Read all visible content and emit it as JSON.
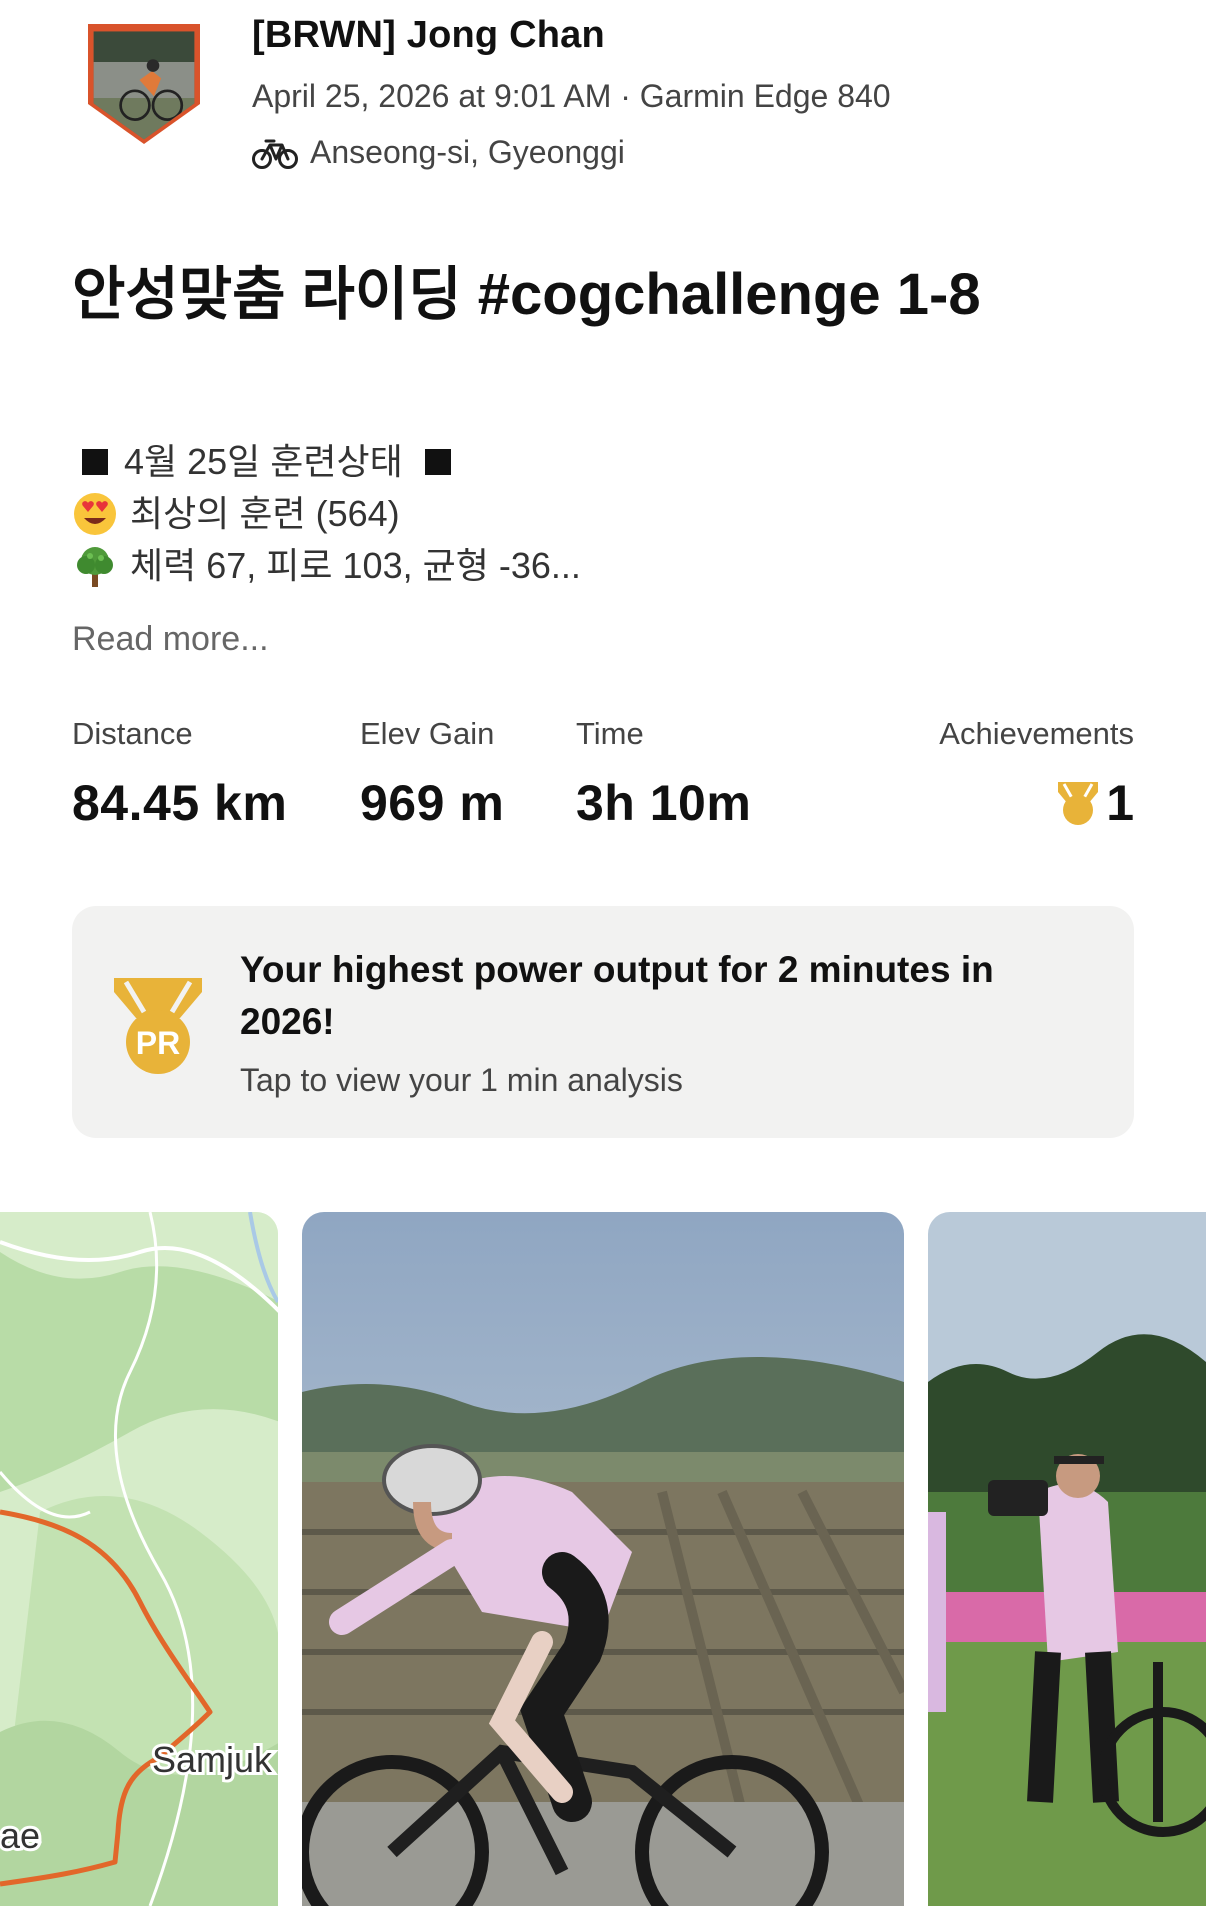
{
  "header": {
    "athlete_name": "[BRWN] Jong Chan",
    "meta": "April 25, 2026 at 9:01 AM · Garmin Edge 840",
    "location": "Anseong-si, Gyeonggi",
    "activity_icon": "bike-icon"
  },
  "activity": {
    "title": "안성맞춤 라이딩 #cogchallenge 1-8",
    "description": [
      {
        "icon": "black-square",
        "text": "4월 25일 훈련상태",
        "trailing_icon": "black-square"
      },
      {
        "icon": "heart-eyes-emoji",
        "text": "최상의 훈련 (564)"
      },
      {
        "icon": "tree-emoji",
        "text": "체력 67, 피로 103, 균형 -36..."
      }
    ],
    "read_more": "Read more..."
  },
  "stats": {
    "distance": {
      "label": "Distance",
      "value": "84.45 km"
    },
    "elevation": {
      "label": "Elev Gain",
      "value": "969 m"
    },
    "time": {
      "label": "Time",
      "value": "3h 10m"
    },
    "achievements": {
      "label": "Achievements",
      "value": "1",
      "icon": "trophy-icon"
    }
  },
  "pr_card": {
    "icon": "pr-medal-icon",
    "title": "Your highest power output for 2 minutes in 2026!",
    "subtitle": "Tap to view your 1 min analysis"
  },
  "media": {
    "map_labels": [
      "Samjuk",
      "ae"
    ]
  },
  "colors": {
    "accent_orange": "#fc5200",
    "route": "#e2672a",
    "gold": "#e8b339",
    "card_bg": "#f2f2f1"
  }
}
